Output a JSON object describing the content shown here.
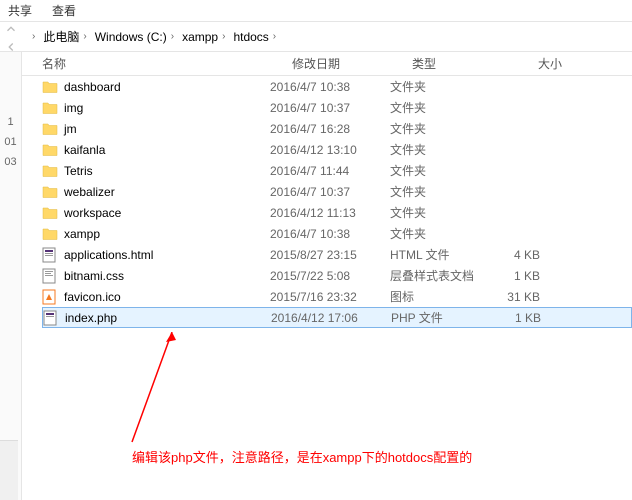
{
  "toolbar": {
    "share": "共享",
    "view": "查看"
  },
  "breadcrumb": {
    "items": [
      {
        "label": ""
      },
      {
        "label": "此电脑"
      },
      {
        "label": "Windows (C:)"
      },
      {
        "label": "xampp"
      },
      {
        "label": "htdocs"
      }
    ]
  },
  "columns": {
    "name": "名称",
    "date": "修改日期",
    "type": "类型",
    "size": "大小"
  },
  "sidebar_fragments": [
    "1",
    "01",
    "03"
  ],
  "files": [
    {
      "icon": "folder",
      "name": "dashboard",
      "date": "2016/4/7 10:38",
      "type": "文件夹",
      "size": ""
    },
    {
      "icon": "folder",
      "name": "img",
      "date": "2016/4/7 10:37",
      "type": "文件夹",
      "size": ""
    },
    {
      "icon": "folder",
      "name": "jm",
      "date": "2016/4/7 16:28",
      "type": "文件夹",
      "size": ""
    },
    {
      "icon": "folder",
      "name": "kaifanla",
      "date": "2016/4/12 13:10",
      "type": "文件夹",
      "size": ""
    },
    {
      "icon": "folder",
      "name": "Tetris",
      "date": "2016/4/7 11:44",
      "type": "文件夹",
      "size": ""
    },
    {
      "icon": "folder",
      "name": "webalizer",
      "date": "2016/4/7 10:37",
      "type": "文件夹",
      "size": ""
    },
    {
      "icon": "folder",
      "name": "workspace",
      "date": "2016/4/12 11:13",
      "type": "文件夹",
      "size": ""
    },
    {
      "icon": "folder",
      "name": "xampp",
      "date": "2016/4/7 10:38",
      "type": "文件夹",
      "size": ""
    },
    {
      "icon": "html",
      "name": "applications.html",
      "date": "2015/8/27 23:15",
      "type": "HTML 文件",
      "size": "4 KB"
    },
    {
      "icon": "css",
      "name": "bitnami.css",
      "date": "2015/7/22 5:08",
      "type": "层叠样式表文档",
      "size": "1 KB"
    },
    {
      "icon": "ico",
      "name": "favicon.ico",
      "date": "2015/7/16 23:32",
      "type": "图标",
      "size": "31 KB"
    },
    {
      "icon": "php",
      "name": "index.php",
      "date": "2016/4/12 17:06",
      "type": "PHP 文件",
      "size": "1 KB",
      "selected": true
    }
  ],
  "annotation": {
    "text": "编辑该php文件，注意路径，是在xampp下的hotdocs配置的"
  }
}
